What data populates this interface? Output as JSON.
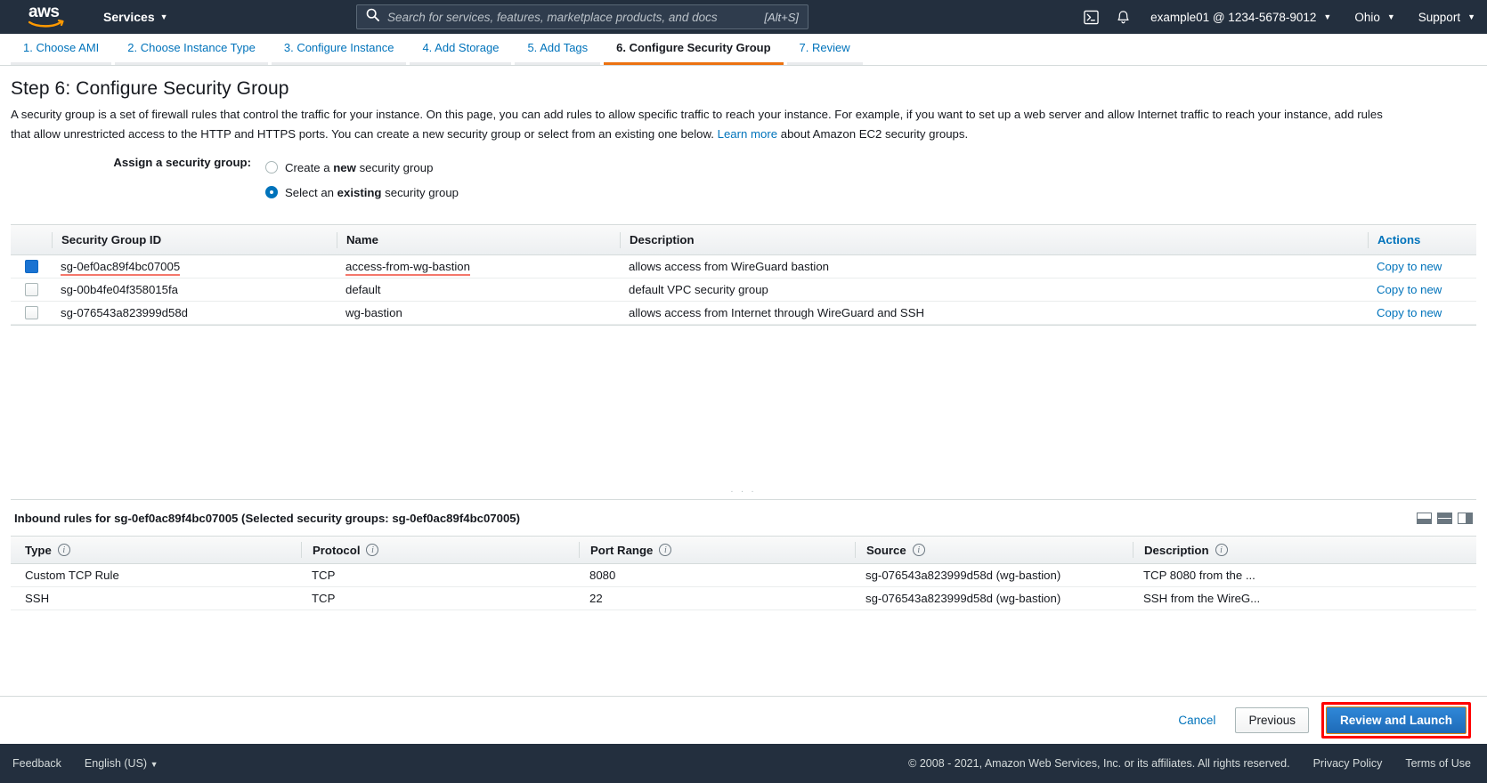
{
  "topnav": {
    "logo_text": "aws",
    "services_label": "Services",
    "search_placeholder": "Search for services, features, marketplace products, and docs",
    "search_value": "",
    "search_shortcut": "[Alt+S]",
    "cloudshell_icon": "cloudshell-icon",
    "bell_icon": "bell-icon",
    "account_label": "example01 @ 1234-5678-9012",
    "region_label": "Ohio",
    "support_label": "Support",
    "bar_color": "#232f3e"
  },
  "wizard": {
    "steps": [
      {
        "label": "1. Choose AMI",
        "active": false
      },
      {
        "label": "2. Choose Instance Type",
        "active": false
      },
      {
        "label": "3. Configure Instance",
        "active": false
      },
      {
        "label": "4. Add Storage",
        "active": false
      },
      {
        "label": "5. Add Tags",
        "active": false
      },
      {
        "label": "6. Configure Security Group",
        "active": true
      },
      {
        "label": "7. Review",
        "active": false
      }
    ],
    "active_accent": "#ec7211"
  },
  "page": {
    "title": "Step 6: Configure Security Group",
    "description_part1": "A security group is a set of firewall rules that control the traffic for your instance. On this page, you can add rules to allow specific traffic to reach your instance. For example, if you want to set up a web server and allow Internet traffic to reach your instance, add rules that allow unrestricted access to the HTTP and HTTPS ports. You can create a new security group or select from an existing one below.",
    "learn_more": "Learn more",
    "description_part2": "about Amazon EC2 security groups."
  },
  "assign": {
    "label": "Assign a security group:",
    "options": [
      {
        "prefix": "Create a ",
        "strong": "new",
        "suffix": " security group",
        "selected": false
      },
      {
        "prefix": "Select an ",
        "strong": "existing",
        "suffix": " security group",
        "selected": true
      }
    ]
  },
  "sg_table": {
    "headers": {
      "id": "Security Group ID",
      "name": "Name",
      "description": "Description",
      "actions": "Actions"
    },
    "rows": [
      {
        "checked": true,
        "id": "sg-0ef0ac89f4bc07005",
        "name": "access-from-wg-bastion",
        "description": "allows access from WireGuard bastion",
        "action": "Copy to new",
        "highlight_id": true,
        "highlight_name": true
      },
      {
        "checked": false,
        "id": "sg-00b4fe04f358015fa",
        "name": "default",
        "description": "default VPC security group",
        "action": "Copy to new",
        "highlight_id": false,
        "highlight_name": false
      },
      {
        "checked": false,
        "id": "sg-076543a823999d58d",
        "name": "wg-bastion",
        "description": "allows access from Internet through WireGuard and SSH",
        "action": "Copy to new",
        "highlight_id": false,
        "highlight_name": false
      }
    ]
  },
  "inbound": {
    "title": "Inbound rules for sg-0ef0ac89f4bc07005 (Selected security groups: sg-0ef0ac89f4bc07005)",
    "headers": {
      "type": "Type",
      "protocol": "Protocol",
      "port_range": "Port Range",
      "source": "Source",
      "description": "Description"
    },
    "rows": [
      {
        "type": "Custom TCP Rule",
        "protocol": "TCP",
        "port_range": "8080",
        "source": "sg-076543a823999d58d (wg-bastion)",
        "description": "TCP 8080 from the ..."
      },
      {
        "type": "SSH",
        "protocol": "TCP",
        "port_range": "22",
        "source": "sg-076543a823999d58d (wg-bastion)",
        "description": "SSH from the WireG..."
      }
    ]
  },
  "footer_actions": {
    "cancel": "Cancel",
    "previous": "Previous",
    "review_and_launch": "Review and Launch",
    "highlight_color": "#ff0000"
  },
  "bottombar": {
    "feedback": "Feedback",
    "language": "English (US)",
    "copyright": "© 2008 - 2021, Amazon Web Services, Inc. or its affiliates. All rights reserved.",
    "privacy": "Privacy Policy",
    "terms": "Terms of Use"
  }
}
